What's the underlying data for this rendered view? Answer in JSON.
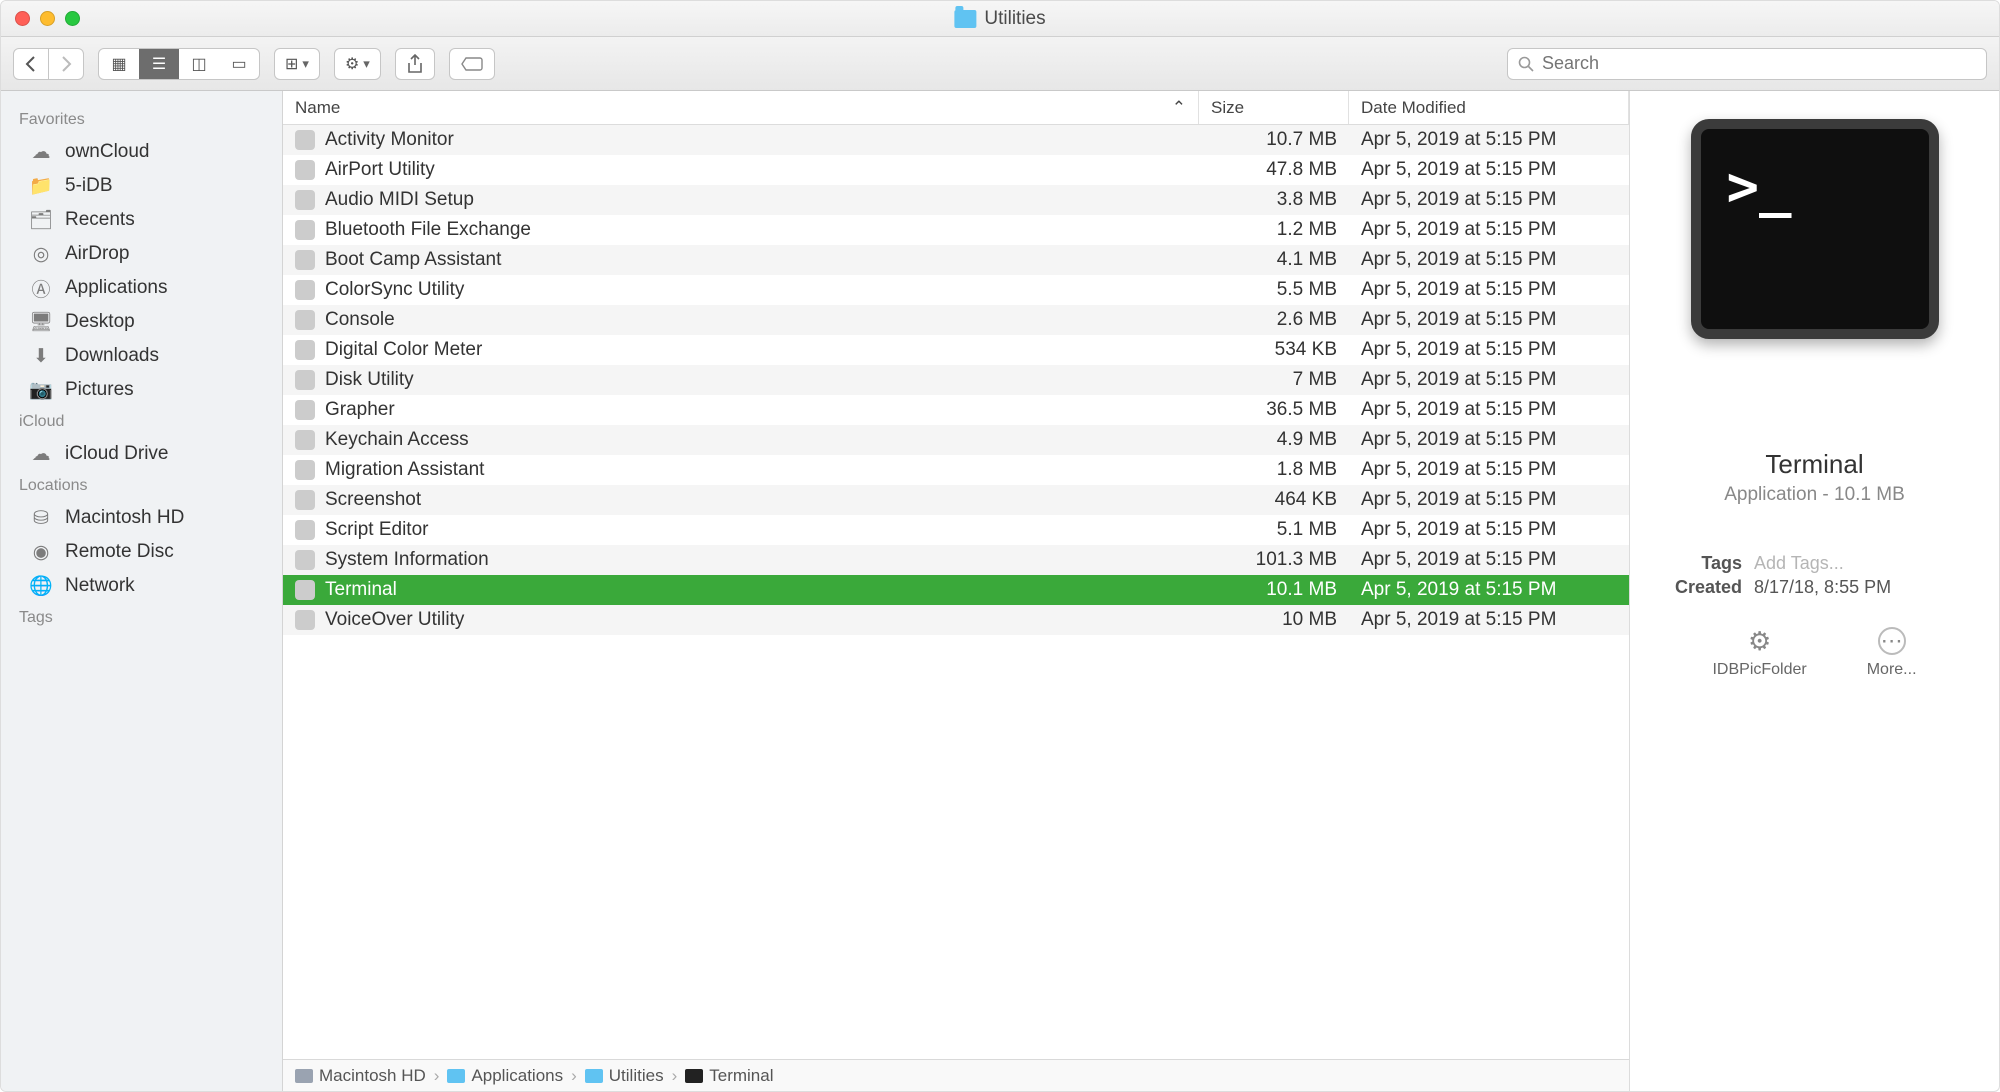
{
  "window": {
    "title": "Utilities"
  },
  "search": {
    "placeholder": "Search"
  },
  "sidebar": {
    "sections": [
      {
        "title": "Favorites",
        "items": [
          {
            "icon": "cloud-icon",
            "label": "ownCloud"
          },
          {
            "icon": "folder-icon",
            "label": "5-iDB"
          },
          {
            "icon": "recents-icon",
            "label": "Recents"
          },
          {
            "icon": "airdrop-icon",
            "label": "AirDrop"
          },
          {
            "icon": "applications-icon",
            "label": "Applications"
          },
          {
            "icon": "desktop-icon",
            "label": "Desktop"
          },
          {
            "icon": "downloads-icon",
            "label": "Downloads"
          },
          {
            "icon": "pictures-icon",
            "label": "Pictures"
          }
        ]
      },
      {
        "title": "iCloud",
        "items": [
          {
            "icon": "icloud-icon",
            "label": "iCloud Drive"
          }
        ]
      },
      {
        "title": "Locations",
        "items": [
          {
            "icon": "disk-icon",
            "label": "Macintosh HD"
          },
          {
            "icon": "disc-icon",
            "label": "Remote Disc"
          },
          {
            "icon": "network-icon",
            "label": "Network"
          }
        ]
      },
      {
        "title": "Tags",
        "items": []
      }
    ]
  },
  "columns": {
    "name": "Name",
    "size": "Size",
    "date": "Date Modified"
  },
  "files": [
    {
      "name": "Activity Monitor",
      "size": "10.7 MB",
      "date": "Apr 5, 2019 at 5:15 PM"
    },
    {
      "name": "AirPort Utility",
      "size": "47.8 MB",
      "date": "Apr 5, 2019 at 5:15 PM"
    },
    {
      "name": "Audio MIDI Setup",
      "size": "3.8 MB",
      "date": "Apr 5, 2019 at 5:15 PM"
    },
    {
      "name": "Bluetooth File Exchange",
      "size": "1.2 MB",
      "date": "Apr 5, 2019 at 5:15 PM"
    },
    {
      "name": "Boot Camp Assistant",
      "size": "4.1 MB",
      "date": "Apr 5, 2019 at 5:15 PM"
    },
    {
      "name": "ColorSync Utility",
      "size": "5.5 MB",
      "date": "Apr 5, 2019 at 5:15 PM"
    },
    {
      "name": "Console",
      "size": "2.6 MB",
      "date": "Apr 5, 2019 at 5:15 PM"
    },
    {
      "name": "Digital Color Meter",
      "size": "534 KB",
      "date": "Apr 5, 2019 at 5:15 PM"
    },
    {
      "name": "Disk Utility",
      "size": "7 MB",
      "date": "Apr 5, 2019 at 5:15 PM"
    },
    {
      "name": "Grapher",
      "size": "36.5 MB",
      "date": "Apr 5, 2019 at 5:15 PM"
    },
    {
      "name": "Keychain Access",
      "size": "4.9 MB",
      "date": "Apr 5, 2019 at 5:15 PM"
    },
    {
      "name": "Migration Assistant",
      "size": "1.8 MB",
      "date": "Apr 5, 2019 at 5:15 PM"
    },
    {
      "name": "Screenshot",
      "size": "464 KB",
      "date": "Apr 5, 2019 at 5:15 PM"
    },
    {
      "name": "Script Editor",
      "size": "5.1 MB",
      "date": "Apr 5, 2019 at 5:15 PM"
    },
    {
      "name": "System Information",
      "size": "101.3 MB",
      "date": "Apr 5, 2019 at 5:15 PM"
    },
    {
      "name": "Terminal",
      "size": "10.1 MB",
      "date": "Apr 5, 2019 at 5:15 PM",
      "selected": true
    },
    {
      "name": "VoiceOver Utility",
      "size": "10 MB",
      "date": "Apr 5, 2019 at 5:15 PM"
    }
  ],
  "preview": {
    "name": "Terminal",
    "subtitle": "Application - 10.1 MB",
    "tags_label": "Tags",
    "tags_placeholder": "Add Tags...",
    "created_label": "Created",
    "created_value": "8/17/18, 8:55 PM",
    "action1": "IDBPicFolder",
    "action2": "More..."
  },
  "pathbar": [
    {
      "icon": "disk",
      "label": "Macintosh HD"
    },
    {
      "icon": "blue",
      "label": "Applications"
    },
    {
      "icon": "blue",
      "label": "Utilities"
    },
    {
      "icon": "term",
      "label": "Terminal"
    }
  ]
}
